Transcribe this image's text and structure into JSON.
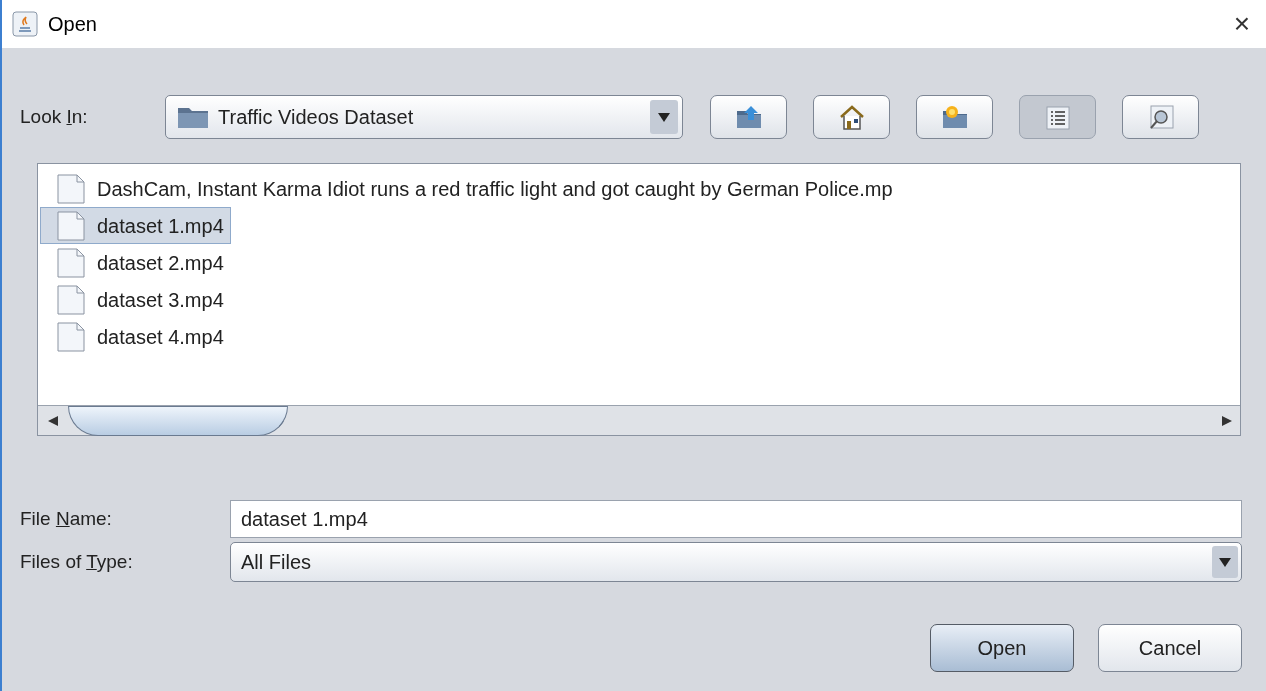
{
  "window": {
    "title": "Open",
    "close": "×"
  },
  "look_in": {
    "label": {
      "before": "Look ",
      "key": "I",
      "after": "n:"
    },
    "value": "Traffic Videos Dataset"
  },
  "toolbar": [
    {
      "kind": "up",
      "selected": false
    },
    {
      "kind": "home",
      "selected": false
    },
    {
      "kind": "new_folder",
      "selected": false
    },
    {
      "kind": "list",
      "selected": true
    },
    {
      "kind": "details",
      "selected": false
    }
  ],
  "files": [
    {
      "name": "DashCam, Instant Karma  Idiot runs a red traffic light and got caught by German Police.mp",
      "selected": false
    },
    {
      "name": "dataset 1.mp4",
      "selected": true
    },
    {
      "name": "dataset 2.mp4",
      "selected": false
    },
    {
      "name": "dataset 3.mp4",
      "selected": false
    },
    {
      "name": "dataset 4.mp4",
      "selected": false
    }
  ],
  "file_name": {
    "label": {
      "before": "File ",
      "key": "N",
      "after": "ame:"
    },
    "value": "dataset 1.mp4"
  },
  "file_type": {
    "label": {
      "before": "Files of ",
      "key": "T",
      "after": "ype:"
    },
    "value": "All Files"
  },
  "buttons": [
    {
      "label": "Open",
      "kind": "primary"
    },
    {
      "label": "Cancel",
      "kind": "secondary"
    }
  ]
}
